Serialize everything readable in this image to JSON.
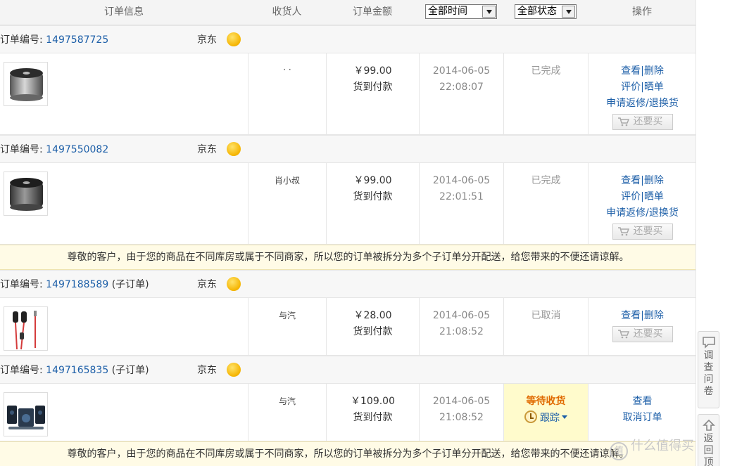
{
  "header": {
    "order_info": "订单信息",
    "receiver": "收货人",
    "amount": "订单金额",
    "time_filter": "全部时间",
    "status_filter": "全部状态",
    "actions": "操作"
  },
  "order_label": "订单编号:",
  "shop_name": "京东",
  "orders": [
    {
      "number": "1497587725",
      "suffix": "",
      "receiver": "·  ·",
      "price": "￥99.00",
      "pay": "货到付款",
      "date": "2014-06-05",
      "time": "22:08:07",
      "status": "已完成",
      "ops": {
        "view": "查看",
        "sep": "|",
        "delete": "删除",
        "rate": "评价",
        "show": "晒单",
        "repair": "申请返修/退换货",
        "rebuy": "还要买"
      }
    },
    {
      "number": "1497550082",
      "suffix": "",
      "receiver": "肖小叔",
      "price": "￥99.00",
      "pay": "货到付款",
      "date": "2014-06-05",
      "time": "22:01:51",
      "status": "已完成",
      "ops": {
        "view": "查看",
        "sep": "|",
        "delete": "删除",
        "rate": "评价",
        "show": "晒单",
        "repair": "申请返修/退换货",
        "rebuy": "还要买"
      }
    },
    {
      "number": "1497188589",
      "suffix": "(子订单)",
      "receiver": "与汽",
      "price": "￥28.00",
      "pay": "货到付款",
      "date": "2014-06-05",
      "time": "21:08:52",
      "status": "已取消",
      "ops": {
        "view": "查看",
        "sep": "|",
        "delete": "删除",
        "rebuy": "还要买"
      }
    },
    {
      "number": "1497165835",
      "suffix": "(子订单)",
      "receiver": "与汽",
      "price": "￥109.00",
      "pay": "货到付款",
      "date": "2014-06-05",
      "time": "21:08:52",
      "status": "等待收货",
      "track": "跟踪",
      "ops": {
        "view": "查看",
        "cancel": "取消订单"
      }
    }
  ],
  "notice": "尊敬的客户，由于您的商品在不同库房或属于不同商家，所以您的订单被拆分为多个子订单分开配送，给您带来的不便还请谅解。",
  "tools": {
    "survey": [
      "调",
      "查",
      "问",
      "卷"
    ],
    "back": [
      "返",
      "回",
      "顶"
    ]
  },
  "watermark": "什么值得买",
  "watermark_logo": "值",
  "colors": {
    "link": "#1d5fa8",
    "waiting": "#e06a00",
    "notice_bg": "#fffbe6"
  }
}
